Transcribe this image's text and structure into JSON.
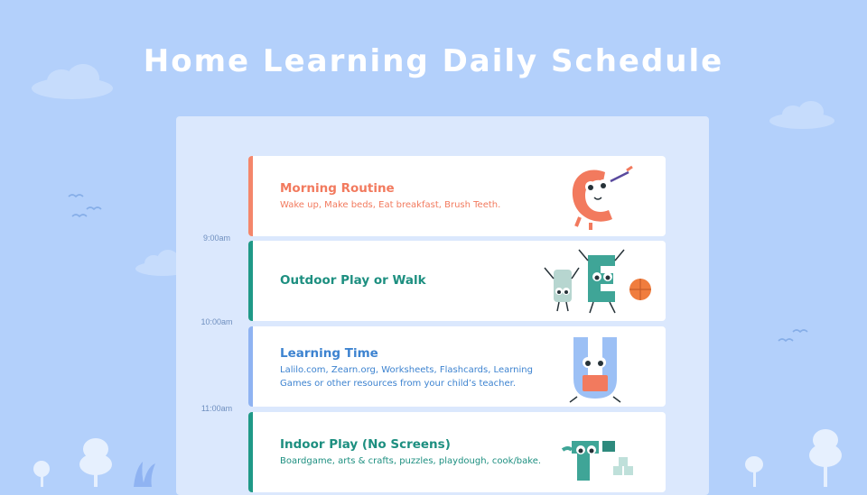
{
  "page": {
    "title": "Home Learning Daily Schedule"
  },
  "colors": {
    "background": "#b3d0fb",
    "panel": "#dbe8fd",
    "coral": "#f27a5e",
    "teal": "#1d8f80",
    "blue": "#3d83d0",
    "time_text": "#6f8fbf"
  },
  "timeline": {
    "times": [
      "9:00am",
      "10:00am",
      "11:00am"
    ]
  },
  "schedule": [
    {
      "title": "Morning Routine",
      "description": "Wake up, Make beds, Eat breakfast, Brush Teeth.",
      "accent": "#f4866b",
      "title_color": "#f27a5e",
      "desc_color": "#f27a5e",
      "icon": "letter-c-monster-brushing-teeth-icon"
    },
    {
      "title": "Outdoor Play or Walk",
      "description": "",
      "accent": "#1f9987",
      "title_color": "#1d8f80",
      "desc_color": "#1d8f80",
      "icon": "letter-monsters-playing-ball-icon"
    },
    {
      "title": "Learning Time",
      "description": "Lalilo.com, Zearn.org, Worksheets, Flashcards, Learning Games or other resources from your child’s teacher.",
      "accent": "#8fb3f2",
      "title_color": "#3d83d0",
      "desc_color": "#3d83d0",
      "icon": "letter-u-monster-reading-icon"
    },
    {
      "title": "Indoor Play (No Screens)",
      "description": "Boardgame, arts & crafts, puzzles, playdough, cook/bake.",
      "accent": "#1f9987",
      "title_color": "#1d8f80",
      "desc_color": "#1d8f80",
      "icon": "letter-monster-building-blocks-icon"
    }
  ]
}
